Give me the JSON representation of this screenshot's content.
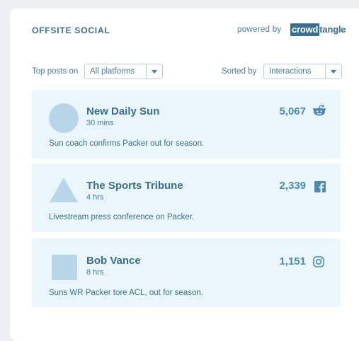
{
  "widget": {
    "title": "OFFSITE SOCIAL",
    "powered_by": "powered by",
    "logo_part1": "crowd",
    "logo_part2": "tangle"
  },
  "filters": {
    "top_posts_label": "Top posts on",
    "platform_value": "All platforms",
    "sorted_label": "Sorted by",
    "sort_value": "Interactions"
  },
  "posts": [
    {
      "name": "New Daily Sun",
      "time": "30 mins",
      "count": "5,067",
      "platform_icon": "reddit-icon",
      "avatar_shape": "circle",
      "text": "Sun coach confirms Packer out for season."
    },
    {
      "name": "The Sports Tribune",
      "time": "4 hrs",
      "count": "2,339",
      "platform_icon": "facebook-icon",
      "avatar_shape": "triangle",
      "text": "Livestream press conference on Packer."
    },
    {
      "name": "Bob Vance",
      "time": "8 hrs",
      "count": "1,151",
      "platform_icon": "instagram-icon",
      "avatar_shape": "square",
      "text": "Suns WR Packer tore ACL, out for season."
    }
  ],
  "colors": {
    "panel_bg": "#ffffff",
    "page_bg": "#eef1f3",
    "card_bg": "#eaf5fc",
    "avatar": "#b9d6e8",
    "accent": "#4d8ab0",
    "text": "#3b6f8f"
  }
}
